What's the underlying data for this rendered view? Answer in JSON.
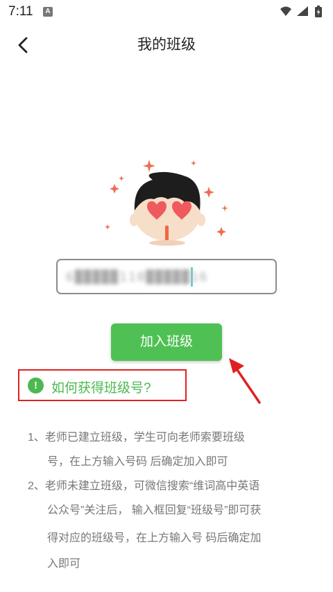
{
  "status_bar": {
    "time": "7:11",
    "notification_letter": "A",
    "icons": [
      "wifi-icon",
      "signal-icon",
      "battery-charging-icon"
    ]
  },
  "header": {
    "back_icon": "chevron-left-icon",
    "title": "我的班级"
  },
  "class_input": {
    "value": "6█████110█████16"
  },
  "join_button": {
    "label": "加入班级"
  },
  "help_link": {
    "icon": "!",
    "label": "如何获得班级号?"
  },
  "instructions": {
    "line1": "1、老师已建立班级，学生可向老师索要班级",
    "line2": "号，在上方输入号码 后确定加入即可",
    "line3": "2、老师未建立班级，可微信搜索“维词高中英语",
    "line4": "公众号”关注后， 输入框回复“班级号”即可获",
    "line5": "得对应的班级号，在上方输入号 码后确定加",
    "line6": "入即可"
  },
  "colors": {
    "accent_green": "#4fc154",
    "annotation_red": "#e02020"
  }
}
